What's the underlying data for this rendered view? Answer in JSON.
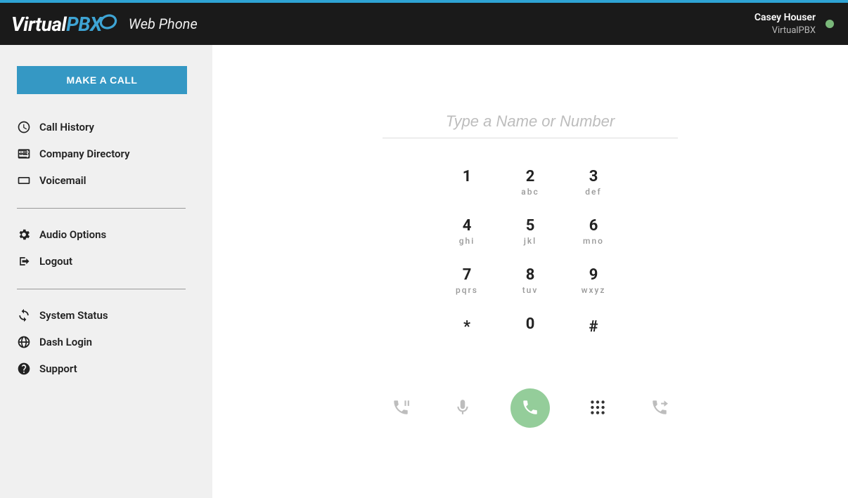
{
  "brand": {
    "logo_a": "Virtual",
    "logo_b": "PBX",
    "app_title": "Web Phone"
  },
  "user": {
    "name": "Casey Houser",
    "org": "VirtualPBX",
    "presence_color": "#7ab87a"
  },
  "sidebar": {
    "make_call": "MAKE A CALL",
    "group_a": [
      {
        "name": "call-history",
        "label": "Call History",
        "icon": "clock"
      },
      {
        "name": "company-directory",
        "label": "Company Directory",
        "icon": "list"
      },
      {
        "name": "voicemail",
        "label": "Voicemail",
        "icon": "voicemail"
      }
    ],
    "group_b": [
      {
        "name": "audio-options",
        "label": "Audio Options",
        "icon": "gear"
      },
      {
        "name": "logout",
        "label": "Logout",
        "icon": "logout"
      }
    ],
    "group_c": [
      {
        "name": "system-status",
        "label": "System Status",
        "icon": "sync"
      },
      {
        "name": "dash-login",
        "label": "Dash Login",
        "icon": "globe"
      },
      {
        "name": "support",
        "label": "Support",
        "icon": "help"
      }
    ]
  },
  "dialer": {
    "placeholder": "Type a Name or Number",
    "keys": [
      {
        "digit": "1",
        "letters": ""
      },
      {
        "digit": "2",
        "letters": "abc"
      },
      {
        "digit": "3",
        "letters": "def"
      },
      {
        "digit": "4",
        "letters": "ghi"
      },
      {
        "digit": "5",
        "letters": "jkl"
      },
      {
        "digit": "6",
        "letters": "mno"
      },
      {
        "digit": "7",
        "letters": "pqrs"
      },
      {
        "digit": "8",
        "letters": "tuv"
      },
      {
        "digit": "9",
        "letters": "wxyz"
      },
      {
        "digit": "*",
        "letters": ""
      },
      {
        "digit": "0",
        "letters": ""
      },
      {
        "digit": "#",
        "letters": ""
      }
    ],
    "controls": [
      {
        "name": "hold",
        "icon": "phone-pause"
      },
      {
        "name": "mute",
        "icon": "mic"
      },
      {
        "name": "call",
        "icon": "phone",
        "primary": true
      },
      {
        "name": "dialpad",
        "icon": "dialpad"
      },
      {
        "name": "transfer",
        "icon": "phone-forward"
      }
    ]
  },
  "colors": {
    "accent": "#3ea4d4",
    "primary_button": "#3598c4",
    "call_green": "#94cd9a"
  }
}
